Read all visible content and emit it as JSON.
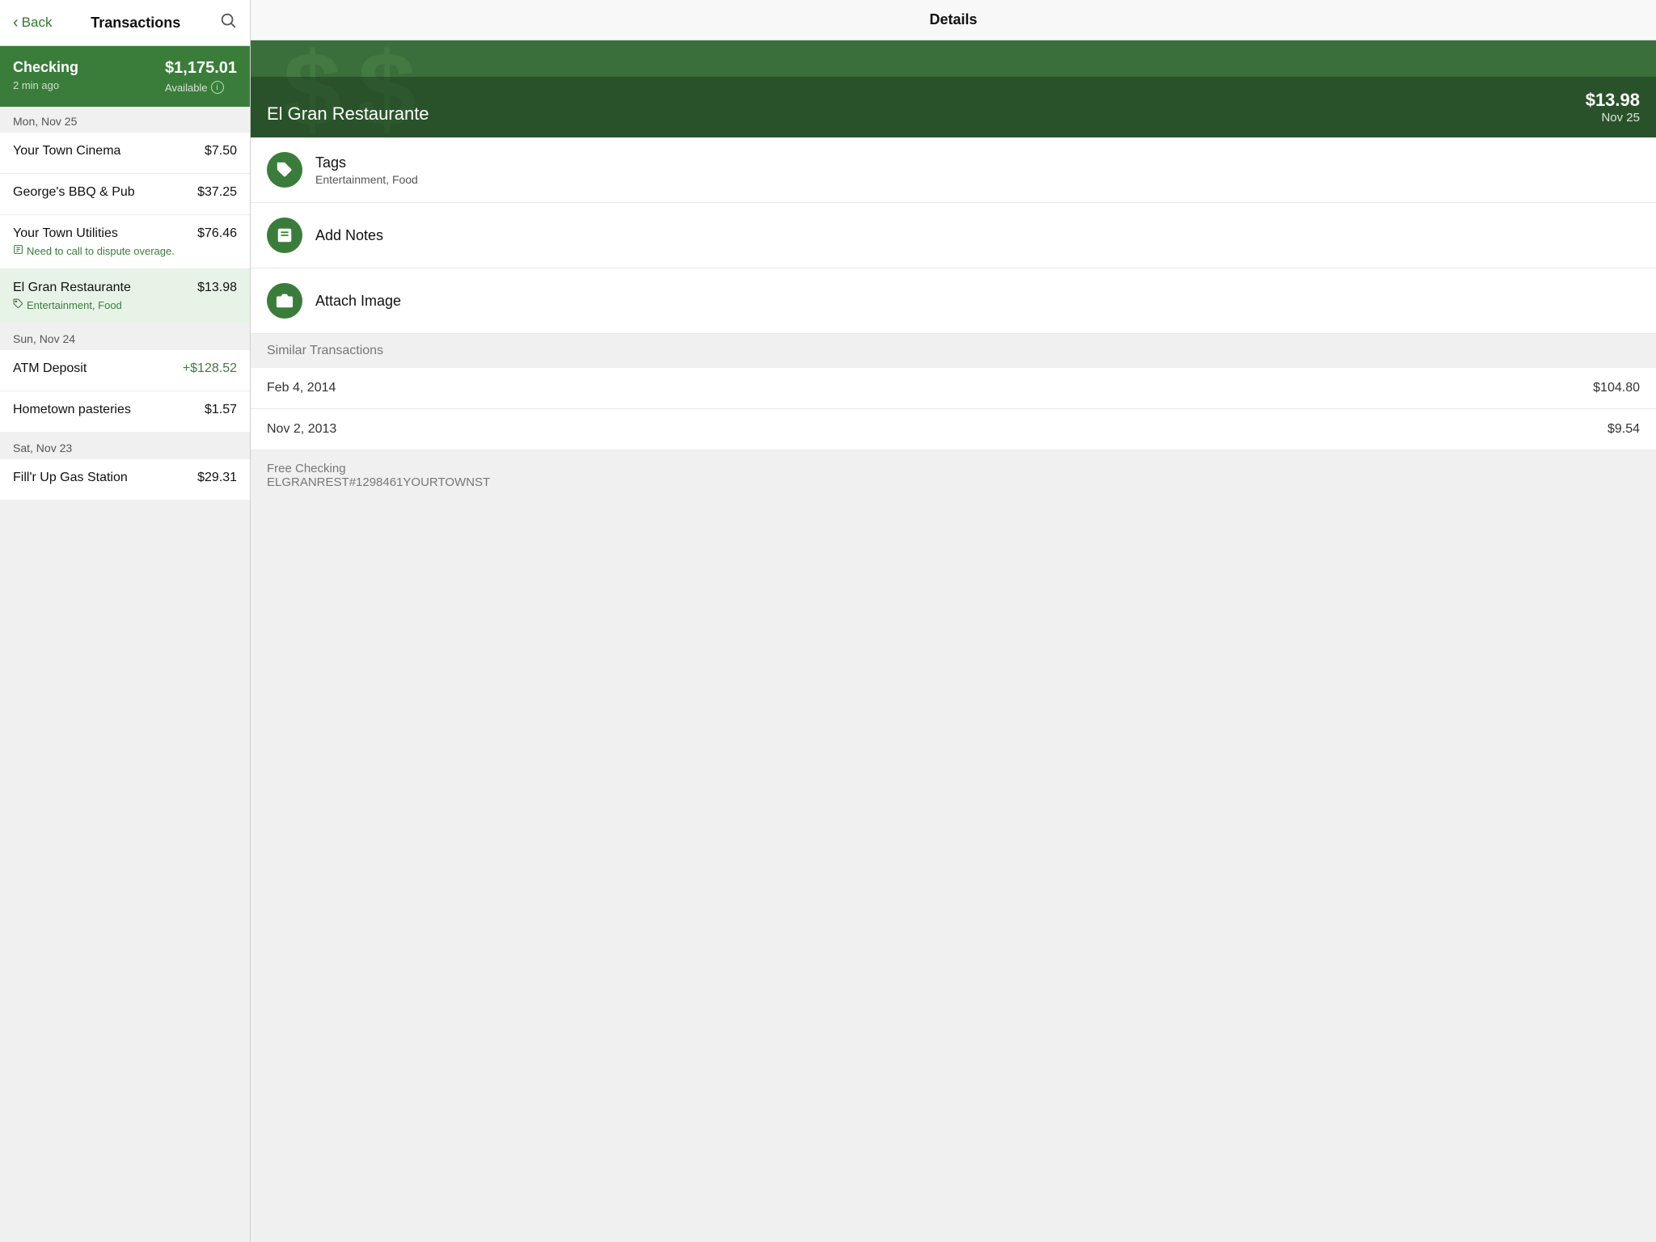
{
  "nav": {
    "back_label": "Back",
    "title": "Transactions",
    "search_icon": "search"
  },
  "account": {
    "name": "Checking",
    "time_ago": "2 min ago",
    "balance": "$1,175.01",
    "available_label": "Available"
  },
  "transaction_groups": [
    {
      "date_label": "Mon, Nov 25",
      "transactions": [
        {
          "id": "t1",
          "name": "Your Town Cinema",
          "amount": "$7.50",
          "positive": false,
          "note": null,
          "tag": null,
          "selected": false
        },
        {
          "id": "t2",
          "name": "George's BBQ & Pub",
          "amount": "$37.25",
          "positive": false,
          "note": null,
          "tag": null,
          "selected": false
        },
        {
          "id": "t3",
          "name": "Your Town Utilities",
          "amount": "$76.46",
          "positive": false,
          "note": "Need to call to dispute overage.",
          "tag": null,
          "selected": false
        },
        {
          "id": "t4",
          "name": "El Gran Restaurante",
          "amount": "$13.98",
          "positive": false,
          "note": null,
          "tag": "Entertainment, Food",
          "selected": true
        }
      ]
    },
    {
      "date_label": "Sun, Nov 24",
      "transactions": [
        {
          "id": "t5",
          "name": "ATM Deposit",
          "amount": "+$128.52",
          "positive": true,
          "note": null,
          "tag": null,
          "selected": false
        },
        {
          "id": "t6",
          "name": "Hometown pasteries",
          "amount": "$1.57",
          "positive": false,
          "note": null,
          "tag": null,
          "selected": false
        }
      ]
    },
    {
      "date_label": "Sat, Nov 23",
      "transactions": [
        {
          "id": "t7",
          "name": "Fill'r Up Gas Station",
          "amount": "$29.31",
          "positive": false,
          "note": null,
          "tag": null,
          "selected": false
        }
      ]
    }
  ],
  "details": {
    "nav_title": "Details",
    "merchant": "El Gran Restaurante",
    "amount": "$13.98",
    "date": "Nov 25",
    "tags_label": "Tags",
    "tags_value": "Entertainment, Food",
    "notes_label": "Add Notes",
    "image_label": "Attach Image",
    "similar_header": "Similar Transactions",
    "similar_transactions": [
      {
        "date": "Feb 4, 2014",
        "amount": "$104.80"
      },
      {
        "date": "Nov 2, 2013",
        "amount": "$9.54"
      }
    ],
    "footer_account": "Free Checking",
    "footer_id": "ELGRANREST#1298461YOURTOWNST"
  }
}
